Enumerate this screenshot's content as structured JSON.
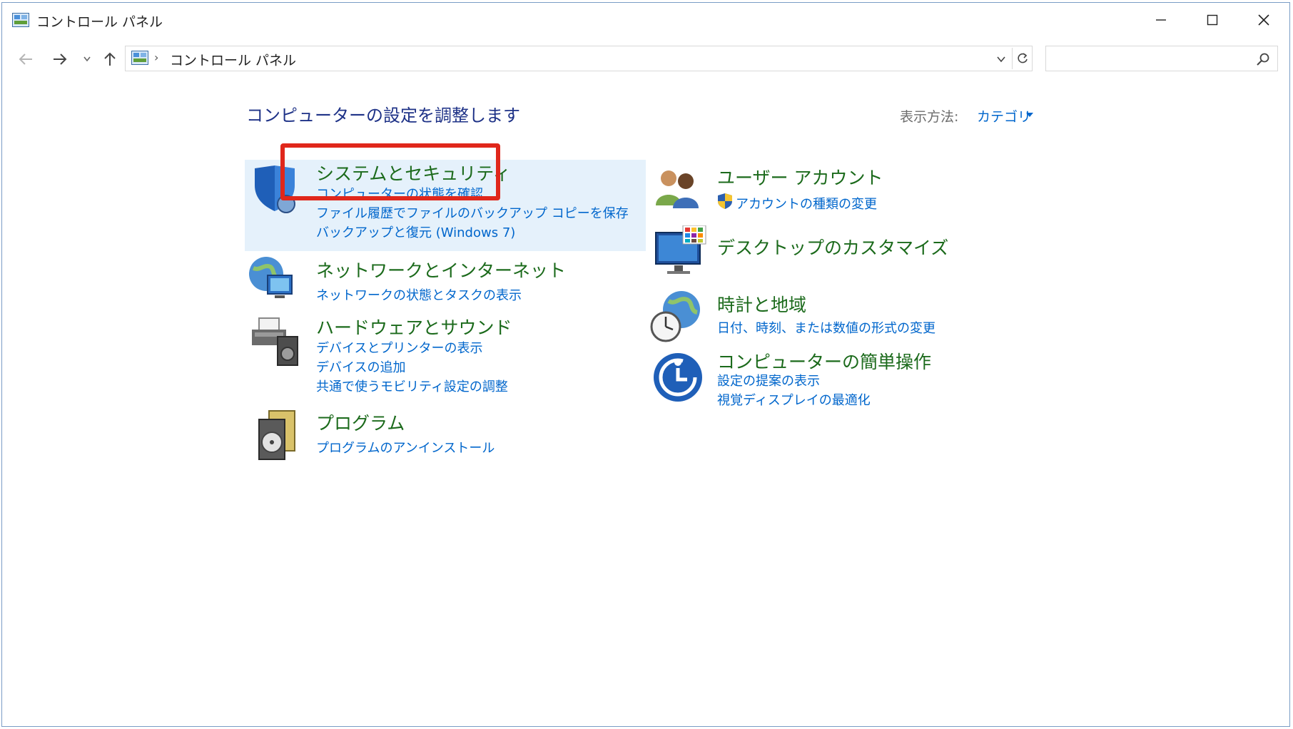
{
  "window": {
    "title": "コントロール パネル"
  },
  "address": {
    "path": "コントロール パネル",
    "separator": "›"
  },
  "search": {
    "placeholder": ""
  },
  "main": {
    "heading": "コンピューターの設定を調整します",
    "view_by_label": "表示方法:",
    "view_by_value": "カテゴリ"
  },
  "categories_left": [
    {
      "title": "システムとセキュリティ",
      "links": [
        "コンピューターの状態を確認",
        "ファイル履歴でファイルのバックアップ コピーを保存",
        "バックアップと復元 (Windows 7)"
      ]
    },
    {
      "title": "ネットワークとインターネット",
      "links": [
        "ネットワークの状態とタスクの表示"
      ]
    },
    {
      "title": "ハードウェアとサウンド",
      "links": [
        "デバイスとプリンターの表示",
        "デバイスの追加",
        "共通で使うモビリティ設定の調整"
      ]
    },
    {
      "title": "プログラム",
      "links": [
        "プログラムのアンインストール"
      ]
    }
  ],
  "categories_right": [
    {
      "title": "ユーザー アカウント",
      "links": [
        "アカウントの種類の変更"
      ]
    },
    {
      "title": "デスクトップのカスタマイズ",
      "links": []
    },
    {
      "title": "時計と地域",
      "links": [
        "日付、時刻、または数値の形式の変更"
      ]
    },
    {
      "title": "コンピューターの簡単操作",
      "links": [
        "設定の提案の表示",
        "視覚ディスプレイの最適化"
      ]
    }
  ],
  "colors": {
    "category_title": "#1b6a1b",
    "link": "#0066cc",
    "heading": "#1e3287",
    "highlight": "#e5f1fb",
    "annotation_box": "#e0271b"
  }
}
